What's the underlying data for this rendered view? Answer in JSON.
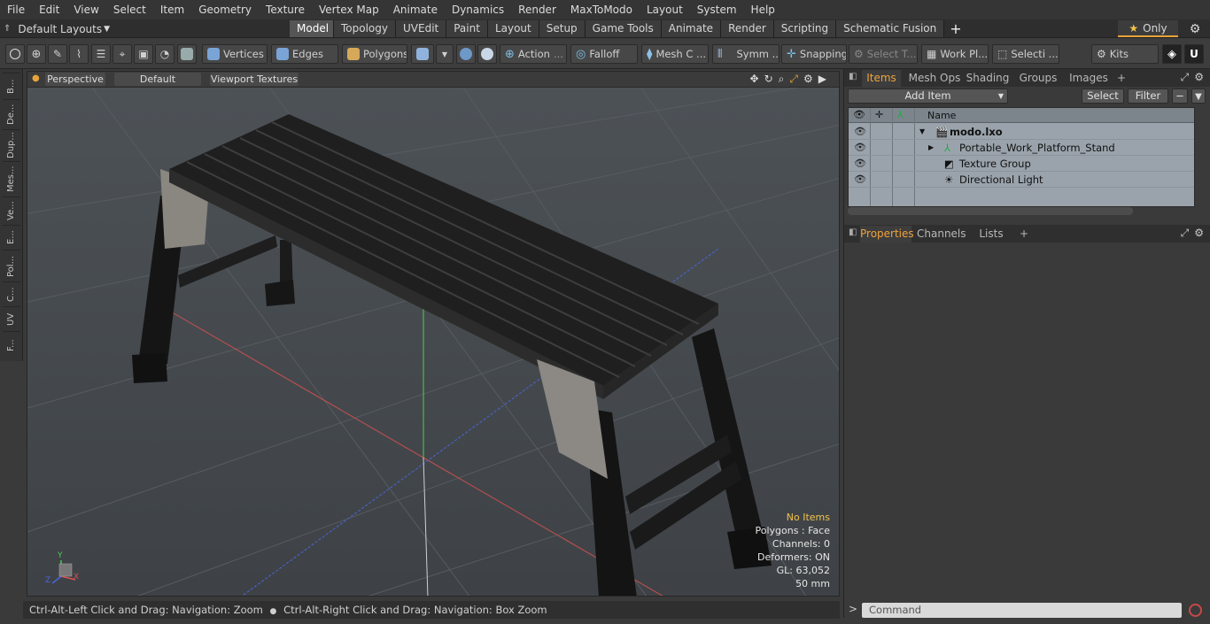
{
  "menu": [
    "File",
    "Edit",
    "View",
    "Select",
    "Item",
    "Geometry",
    "Texture",
    "Vertex Map",
    "Animate",
    "Dynamics",
    "Render",
    "MaxToModo",
    "Layout",
    "System",
    "Help"
  ],
  "layouts_label": "Default Layouts",
  "mode_tabs": [
    "Model",
    "Topology",
    "UVEdit",
    "Paint",
    "Layout",
    "Setup",
    "Game Tools",
    "Animate",
    "Render",
    "Scripting",
    "Schematic Fusion"
  ],
  "active_mode": "Model",
  "only_label": "Only",
  "toolbar": {
    "vertices": "Vertices",
    "edges": "Edges",
    "polygons": "Polygons",
    "action": "Action",
    "falloff": "Falloff",
    "mesh": "Mesh C ...",
    "symmetry": "Symm ...",
    "snapping": "Snapping",
    "select_t": "Select T...",
    "work_plane": "Work Pl...",
    "selection": "Selecti ...",
    "kits": "Kits"
  },
  "left_tabs": [
    "B...",
    "De...",
    "Dup...",
    "Mes...",
    "Ve...",
    "E...",
    "Pol...",
    "C...",
    "UV",
    "F..."
  ],
  "viewport": {
    "perspective": "Perspective",
    "shading": "Default",
    "textures": "Viewport Textures",
    "info": [
      "No Items",
      "Polygons : Face",
      "Channels: 0",
      "Deformers: ON",
      "GL: 63,052",
      "50 mm"
    ],
    "axis_labels": {
      "y": "Y",
      "x": "X",
      "z": "Z"
    }
  },
  "status_text_1": "Ctrl-Alt-Left Click and Drag: Navigation: Zoom",
  "status_text_2": "Ctrl-Alt-Right Click and Drag: Navigation: Box Zoom",
  "items_panel": {
    "tabs": [
      "Items",
      "Mesh Ops",
      "Shading",
      "Groups",
      "Images"
    ],
    "add_item": "Add Item",
    "select": "Select",
    "filter": "Filter",
    "column_name": "Name",
    "rows": [
      "modo.lxo",
      "Portable_Work_Platform_Stand",
      "Texture Group",
      "Directional Light"
    ]
  },
  "properties_panel": {
    "tabs": [
      "Properties",
      "Channels",
      "Lists"
    ]
  },
  "command_placeholder": "Command",
  "colors": {
    "accent": "#f0a33a",
    "list_bg": "#9aa3ab"
  }
}
